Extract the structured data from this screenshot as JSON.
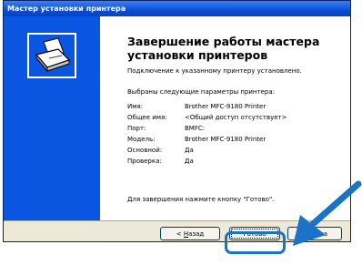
{
  "window": {
    "title": "Мастер установки принтера"
  },
  "heading": "Завершение работы мастера установки принтеров",
  "status_text": "Подключение к указанному принтеру установлено.",
  "params_intro": "Выбраны следующие параметры принтера:",
  "params": [
    {
      "label": "Имя:",
      "value": "Brother MFC-9180 Printer"
    },
    {
      "label": "Общее имя:",
      "value": "<Общий доступ отсутствует>"
    },
    {
      "label": "Порт:",
      "value": "BMFC:"
    },
    {
      "label": "Модель:",
      "value": "Brother MFC-9180 Printer"
    },
    {
      "label": "Основной:",
      "value": "Да"
    },
    {
      "label": "Проверка:",
      "value": "Да"
    }
  ],
  "finish_hint": "Для завершения нажмите кнопку \"Готово\".",
  "buttons": {
    "back_prefix": "< ",
    "back_hotkey": "Н",
    "back_rest": "азад",
    "finish": "Готово",
    "cancel": "Отмена"
  },
  "icons": {
    "sidebar": "printer-icon",
    "annotation": "pointer-arrow-icon"
  },
  "colors": {
    "accent": "#0a56e0",
    "highlight": "#1a73c8"
  }
}
